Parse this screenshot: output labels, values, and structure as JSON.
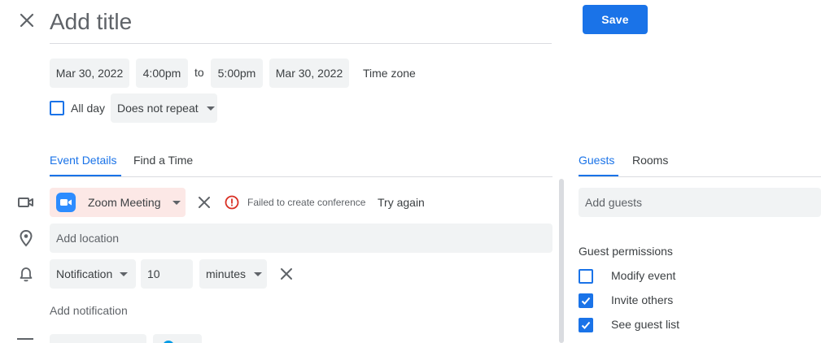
{
  "header": {
    "title_placeholder": "Add title",
    "save_label": "Save"
  },
  "datetime": {
    "start_date": "Mar 30, 2022",
    "start_time": "4:00pm",
    "to_label": "to",
    "end_time": "5:00pm",
    "end_date": "Mar 30, 2022",
    "timezone_label": "Time zone"
  },
  "options": {
    "all_day_label": "All day",
    "all_day_checked": false,
    "repeat_value": "Does not repeat"
  },
  "left_tabs": [
    {
      "label": "Event Details",
      "active": true
    },
    {
      "label": "Find a Time",
      "active": false
    }
  ],
  "conference": {
    "label": "Zoom Meeting",
    "error_text": "Failed to create conference",
    "retry_label": "Try again"
  },
  "location": {
    "placeholder": "Add location"
  },
  "notification": {
    "type": "Notification",
    "amount": "10",
    "unit": "minutes",
    "add_label": "Add notification"
  },
  "right_tabs": [
    {
      "label": "Guests",
      "active": true
    },
    {
      "label": "Rooms",
      "active": false
    }
  ],
  "guests": {
    "add_placeholder": "Add guests",
    "permissions_title": "Guest permissions",
    "permissions": [
      {
        "label": "Modify event",
        "checked": false
      },
      {
        "label": "Invite others",
        "checked": true
      },
      {
        "label": "See guest list",
        "checked": true
      }
    ]
  },
  "colors": {
    "accent": "#1a73e8",
    "zoom_chip_bg": "#fce8e6",
    "error_red": "#d93025",
    "chip_bg": "#f1f3f4"
  },
  "icons": {
    "close": "close-icon",
    "video": "video-camera-icon",
    "location": "map-pin-icon",
    "notification": "bell-icon",
    "error": "error-circle-icon",
    "zoom": "zoom-logo-icon"
  }
}
